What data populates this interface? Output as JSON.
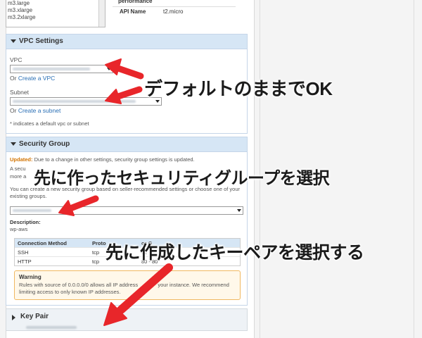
{
  "top": {
    "instance_types": [
      "m3.large",
      "m3.xlarge",
      "m3.2xlarge"
    ],
    "perf_label": "performance",
    "api_name_label": "API Name",
    "api_name_value": "t2.micro"
  },
  "vpc": {
    "title": "VPC Settings",
    "vpc_label": "VPC",
    "or_text": "Or",
    "create_vpc_link": "Create a VPC",
    "subnet_label": "Subnet",
    "create_subnet_link": "Create a subnet",
    "note": "* indicates a default vpc or subnet"
  },
  "sg": {
    "title": "Security Group",
    "updated_label": "Updated:",
    "updated_text": "Due to a change in other settings, security group settings is updated.",
    "line2_start": "A secu",
    "line3_start": "more a",
    "create_text": "You can create a new security group based on seller-recommended settings or choose one of your existing groups.",
    "description_label": "Description:",
    "description_value": "wp-aws",
    "table_headers": [
      "Connection Method",
      "Proto",
      "or G"
    ],
    "rows": [
      {
        "method": "SSH",
        "proto": "tcp",
        "range": "22"
      },
      {
        "method": "HTTP",
        "proto": "tcp",
        "range": "80 - 80"
      }
    ],
    "warning_title": "Warning",
    "warning_text_a": "Rules with source of 0.0.0.0/0 allows all IP address",
    "warning_text_b": "your instance. We recommend",
    "warning_text_c": "limiting access to only known IP addresses."
  },
  "keypair": {
    "title": "Key Pair"
  },
  "annotations": {
    "a1": "デフォルトのままでOK",
    "a2": "先に作ったセキュリティグループを選択",
    "a3": "先に作成したキーペアを選択する"
  },
  "colors": {
    "panel_header": "#d6e6f5",
    "link": "#2a6fb5",
    "updated": "#d27300",
    "arrow_red": "#e8262a",
    "warning_border": "#f0b860"
  }
}
